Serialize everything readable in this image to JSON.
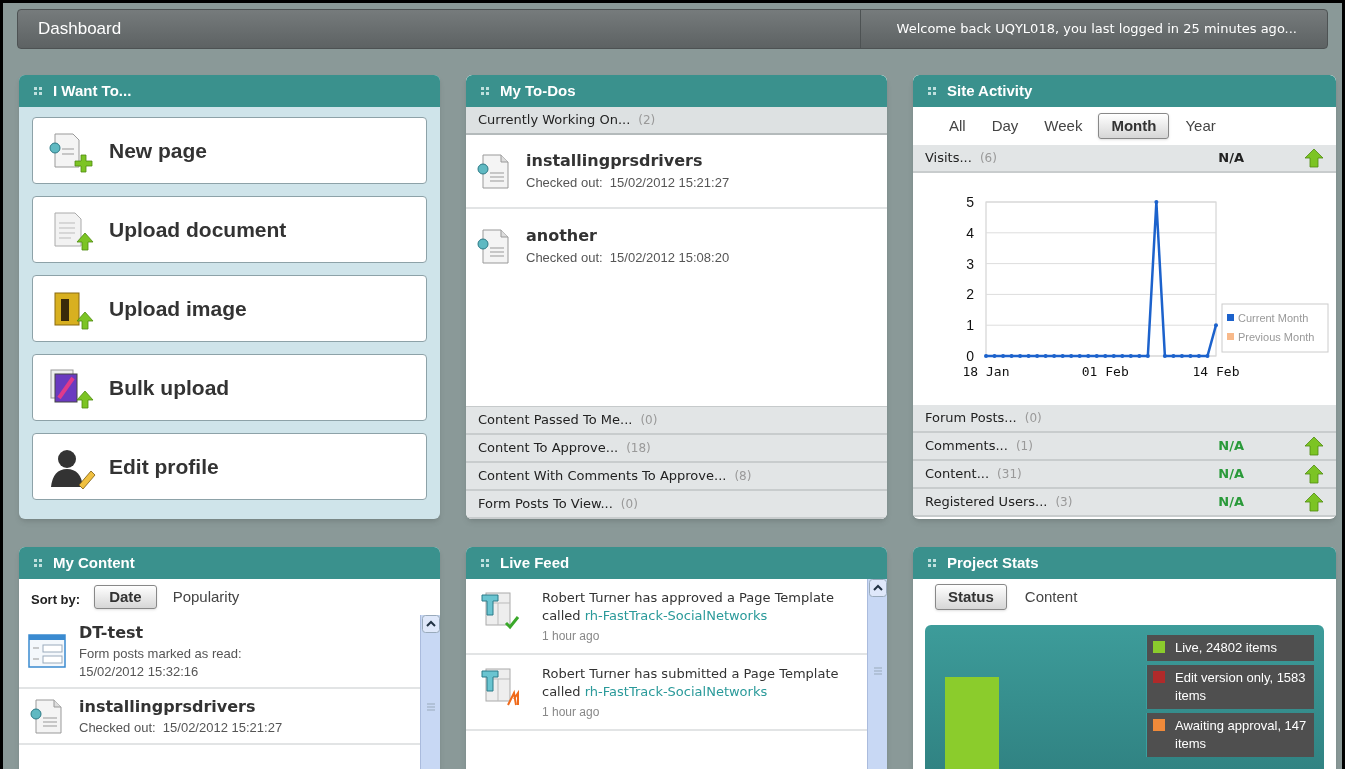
{
  "header": {
    "title": "Dashboard",
    "welcome": "Welcome back UQYL018, you last logged in 25 minutes ago..."
  },
  "i_want_to": {
    "title": "I Want To...",
    "actions": [
      {
        "label": "New page",
        "kind": "new-page"
      },
      {
        "label": "Upload document",
        "kind": "upload-document"
      },
      {
        "label": "Upload image",
        "kind": "upload-image"
      },
      {
        "label": "Bulk upload",
        "kind": "bulk-upload"
      },
      {
        "label": "Edit profile",
        "kind": "edit-profile"
      }
    ]
  },
  "my_todos": {
    "title": "My To-Dos",
    "sections": [
      {
        "label": "Currently Working On...",
        "count": "(2)",
        "expanded": true,
        "items": [
          {
            "name": "installingprsdrivers",
            "detail": "Checked out:  15/02/2012 15:21:27"
          },
          {
            "name": "another",
            "detail": "Checked out:  15/02/2012 15:08:20"
          }
        ]
      },
      {
        "label": "Content Passed To Me...",
        "count": "(0)",
        "expanded": false
      },
      {
        "label": "Content To Approve...",
        "count": "(18)",
        "expanded": false
      },
      {
        "label": "Content With Comments To Approve...",
        "count": "(8)",
        "expanded": false
      },
      {
        "label": "Form Posts To View...",
        "count": "(0)",
        "expanded": false
      }
    ]
  },
  "site_activity": {
    "title": "Site Activity",
    "periods": [
      {
        "label": "All",
        "selected": false
      },
      {
        "label": "Day",
        "selected": false
      },
      {
        "label": "Week",
        "selected": false
      },
      {
        "label": "Month",
        "selected": true
      },
      {
        "label": "Year",
        "selected": false
      }
    ],
    "stats": [
      {
        "label": "Visits...",
        "count": "(6)",
        "value": "N/A",
        "color": "#222222",
        "chart_data": {
          "type": "line",
          "categories": [
            "18 Jan",
            null,
            null,
            null,
            null,
            null,
            null,
            null,
            null,
            null,
            null,
            null,
            null,
            null,
            "01 Feb",
            null,
            null,
            null,
            null,
            null,
            null,
            null,
            null,
            null,
            null,
            null,
            null,
            "14 Feb"
          ],
          "ylim": [
            0,
            5
          ],
          "yticks": [
            0,
            1,
            2,
            3,
            4,
            5
          ],
          "grid": true,
          "legend": true,
          "series": [
            {
              "name": "Current Month",
              "color": "#1c62cc",
              "values": [
                0,
                0,
                0,
                0,
                0,
                0,
                0,
                0,
                0,
                0,
                0,
                0,
                0,
                0,
                0,
                0,
                0,
                0,
                0,
                0,
                5,
                0,
                0,
                0,
                0,
                0,
                0,
                1
              ]
            },
            {
              "name": "Previous Month",
              "color": "#f8b98a",
              "values": [
                null,
                null,
                null,
                null,
                null,
                null,
                null,
                null,
                null,
                null,
                null,
                null,
                null,
                null,
                null,
                null,
                null,
                null,
                null,
                null,
                null,
                null,
                null,
                null,
                null,
                null,
                null,
                null
              ]
            }
          ]
        }
      },
      {
        "label": "Forum Posts...",
        "count": "(0)"
      },
      {
        "label": "Comments...",
        "count": "(1)",
        "value": "N/A",
        "color": "#2a9a3a"
      },
      {
        "label": "Content...",
        "count": "(31)",
        "value": "N/A",
        "color": "#2a9a3a"
      },
      {
        "label": "Registered Users...",
        "count": "(3)",
        "value": "N/A",
        "color": "#2a9a3a"
      }
    ]
  },
  "my_content": {
    "title": "My Content",
    "sort_label": "Sort by:",
    "sort_options": [
      {
        "label": "Date",
        "selected": true
      },
      {
        "label": "Popularity",
        "selected": false
      }
    ],
    "items": [
      {
        "kind": "form",
        "name": "DT-test",
        "detail": "Form posts marked as read:",
        "detail_2": "15/02/2012 15:32:16"
      },
      {
        "kind": "page",
        "name": "installingprsdrivers",
        "detail": "Checked out:  15/02/2012 15:21:27"
      }
    ]
  },
  "live_feed": {
    "title": "Live Feed",
    "items": [
      {
        "kind": "approved",
        "text": "Robert Turner has approved a Page Template called",
        "link": "rh-FastTrack-SocialNetworks",
        "time": "1 hour ago"
      },
      {
        "kind": "submitted",
        "text": "Robert Turner has submitted a Page Template called",
        "link": "rh-FastTrack-SocialNetworks",
        "time": "1 hour ago"
      }
    ]
  },
  "project_stats": {
    "title": "Project Stats",
    "tabs": [
      {
        "label": "Status",
        "selected": true
      },
      {
        "label": "Content",
        "selected": false
      }
    ],
    "legend": [
      {
        "label": "Live, 24802 items",
        "color": "#8bcc2c"
      },
      {
        "label": "Edit version only, 1583 items",
        "color": "#b02a2a"
      },
      {
        "label": "Awaiting approval, 147 items",
        "color": "#f08a3a"
      }
    ]
  }
}
